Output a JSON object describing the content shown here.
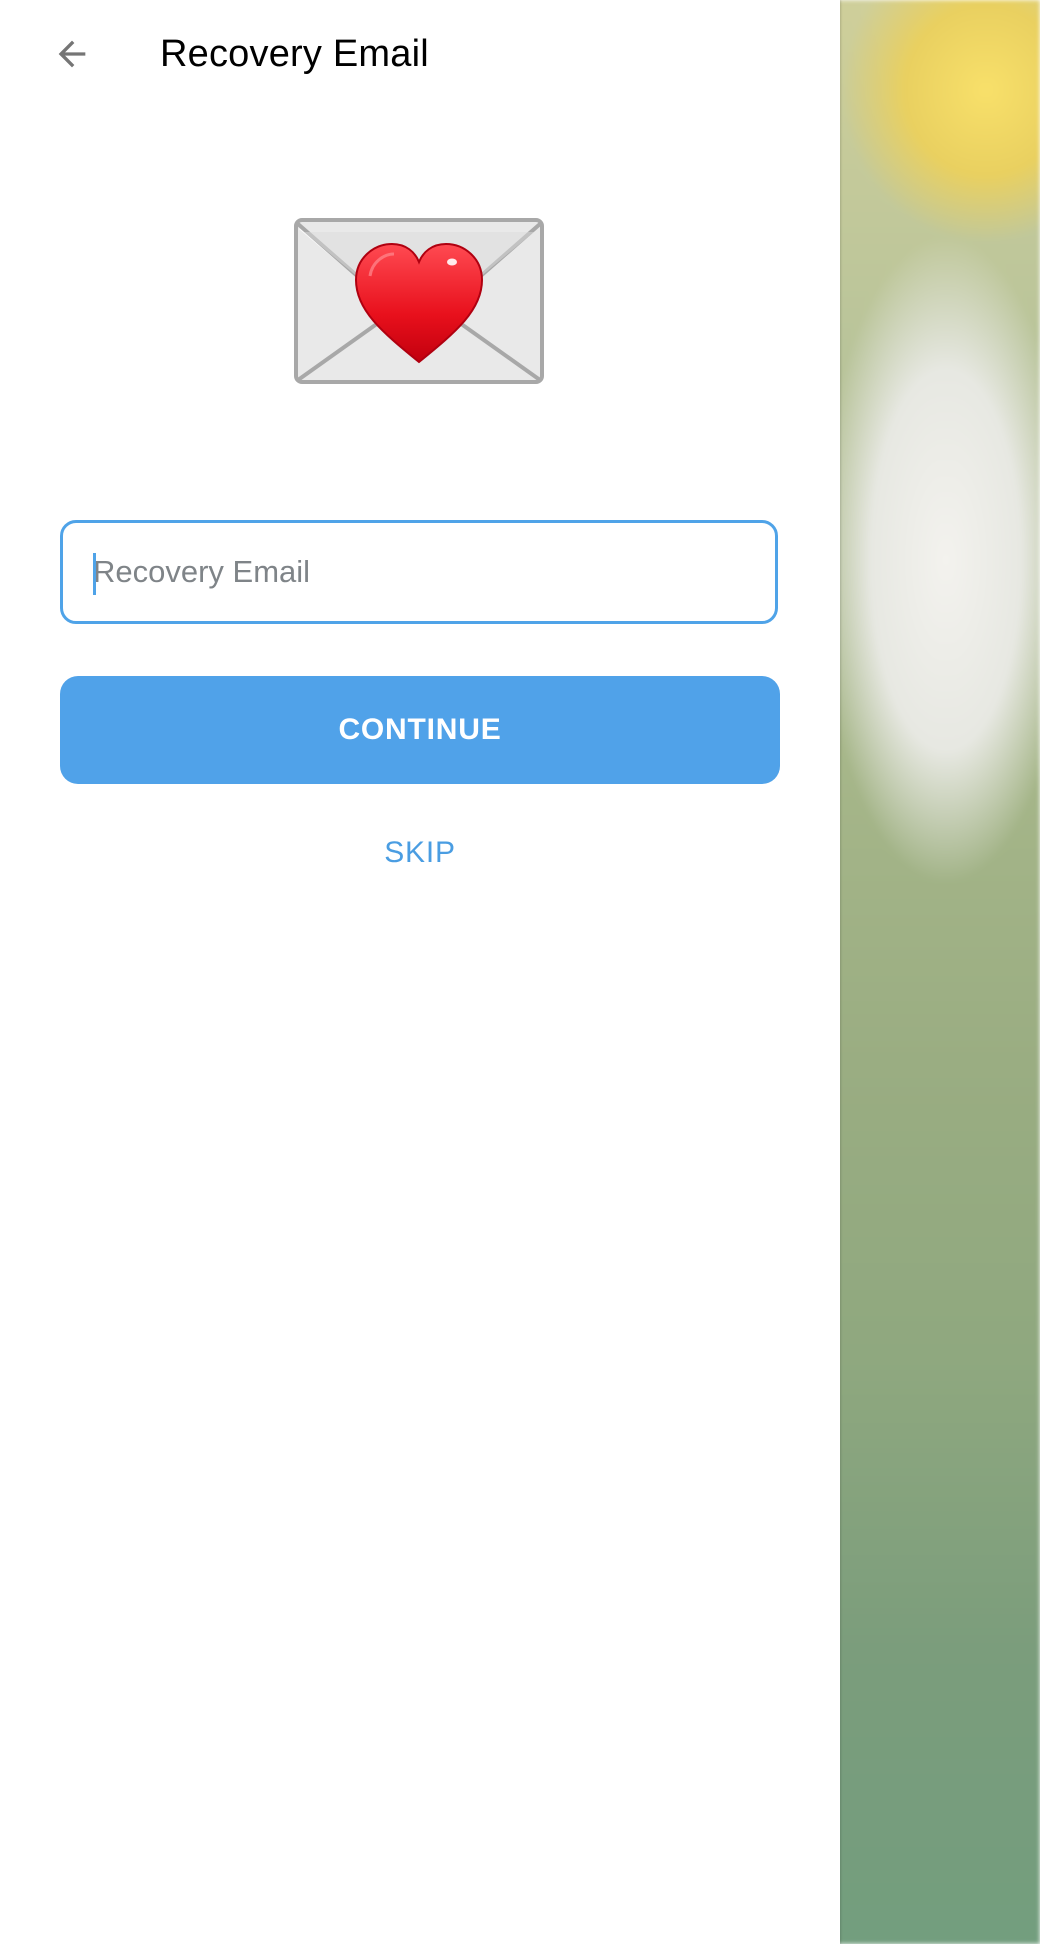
{
  "header": {
    "title": "Recovery Email",
    "back_icon": "arrow-left-icon"
  },
  "illustration": {
    "icon": "love-letter-envelope-icon"
  },
  "form": {
    "email_placeholder": "Recovery Email",
    "email_value": "",
    "continue_label": "CONTINUE",
    "skip_label": "SKIP"
  },
  "colors": {
    "accent": "#50a2e9",
    "field_border": "#4fa3e8",
    "title_text": "#000000",
    "heart": "#e8101c"
  }
}
